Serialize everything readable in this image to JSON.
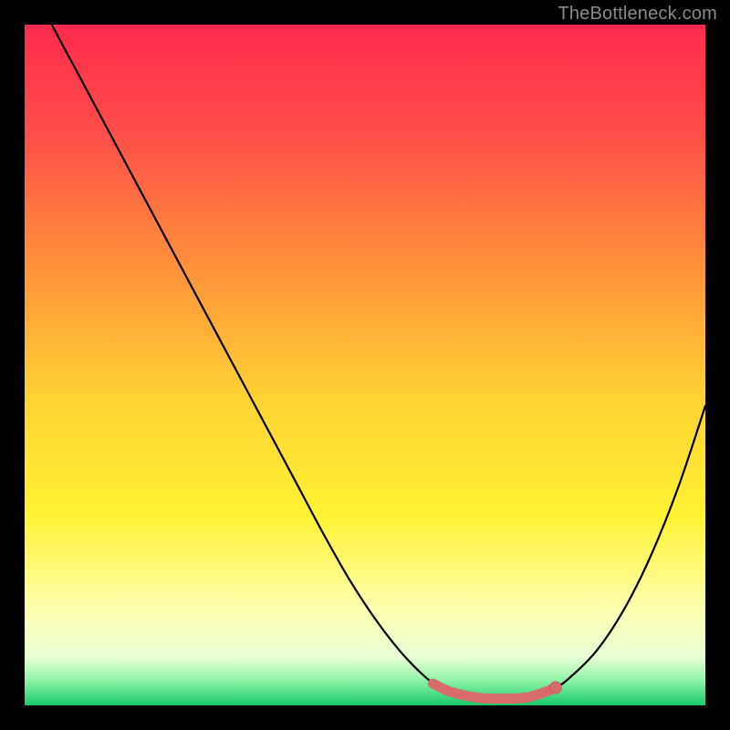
{
  "watermark": "TheBottleneck.com",
  "colors": {
    "background": "#000000",
    "curve": "#000000",
    "marker_fill": "#d86b6b",
    "marker_stroke": "#c55a5a",
    "gradient_stops": [
      {
        "offset": 0.0,
        "color": "#ff2b4e"
      },
      {
        "offset": 0.15,
        "color": "#ff4b4a"
      },
      {
        "offset": 0.35,
        "color": "#ff8f3a"
      },
      {
        "offset": 0.55,
        "color": "#ffd334"
      },
      {
        "offset": 0.72,
        "color": "#fff233"
      },
      {
        "offset": 0.86,
        "color": "#fdffb0"
      },
      {
        "offset": 0.93,
        "color": "#e8ffd6"
      },
      {
        "offset": 0.965,
        "color": "#8af2a3"
      },
      {
        "offset": 1.0,
        "color": "#18c96b"
      }
    ]
  },
  "chart_data": {
    "type": "line",
    "title": "",
    "xlabel": "",
    "ylabel": "",
    "xlim": [
      0,
      100
    ],
    "ylim": [
      0,
      100
    ],
    "series": [
      {
        "name": "bottleneck-curve",
        "x": [
          0,
          4,
          8,
          12,
          16,
          20,
          24,
          28,
          32,
          36,
          40,
          44,
          48,
          52,
          56,
          60,
          62,
          64,
          66,
          68,
          70,
          72,
          74,
          76,
          78,
          80,
          84,
          88,
          92,
          96,
          100
        ],
        "y": [
          108,
          100,
          92.5,
          85,
          77.5,
          70,
          62.5,
          55,
          47.5,
          40,
          32.5,
          25,
          18,
          12,
          7,
          3.2,
          2.2,
          1.6,
          1.2,
          1.0,
          1.0,
          1.0,
          1.2,
          1.8,
          2.6,
          4.0,
          8,
          14,
          22,
          32,
          44
        ]
      }
    ],
    "markers": {
      "name": "highlight-segment",
      "x": [
        60,
        62,
        64,
        66,
        68,
        70,
        72,
        74,
        76,
        78
      ],
      "y": [
        3.2,
        2.2,
        1.6,
        1.2,
        1.0,
        1.0,
        1.0,
        1.2,
        1.8,
        2.6
      ]
    },
    "dot": {
      "x": 78,
      "y": 2.6
    }
  }
}
